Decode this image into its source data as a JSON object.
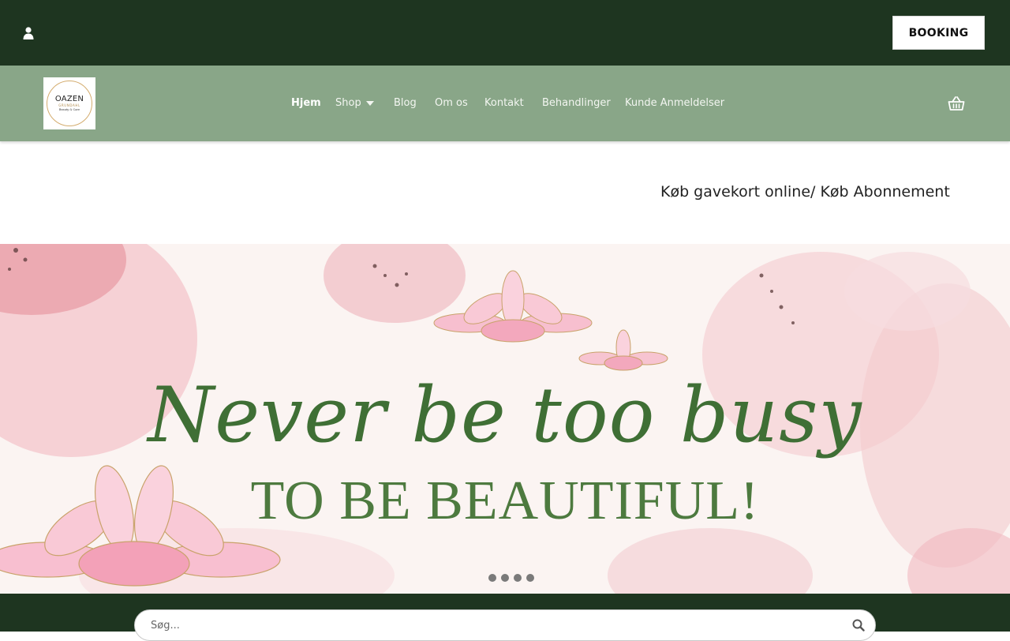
{
  "header": {
    "booking_label": "BOOKING",
    "user_icon": "user-icon"
  },
  "nav": {
    "logo": {
      "name": "OAZEN",
      "sub": "GRUNDAHL",
      "tagline": "Beauty & Care"
    },
    "items": [
      {
        "label": "Hjem",
        "active": true
      },
      {
        "label": "Shop",
        "has_dropdown": true
      },
      {
        "label": "Blog"
      },
      {
        "label": "Om os"
      },
      {
        "label": "Kontakt"
      },
      {
        "label": "Behandlinger"
      },
      {
        "label": "Kunde Anmeldelser"
      }
    ],
    "cart_icon": "basket-icon"
  },
  "promo": {
    "gift_link": "Køb gavekort online/ Køb Abonnement"
  },
  "hero": {
    "headline": "Never be too busy",
    "subline": "TO BE BEAUTIFUL!",
    "slide_count": 4
  },
  "footer": {
    "search_placeholder": "Søg..."
  },
  "colors": {
    "topbar": "#1e3520",
    "navbar": "#89a688",
    "headline_green": "#3f6f35",
    "flower_pink": "#f7bfcf"
  }
}
